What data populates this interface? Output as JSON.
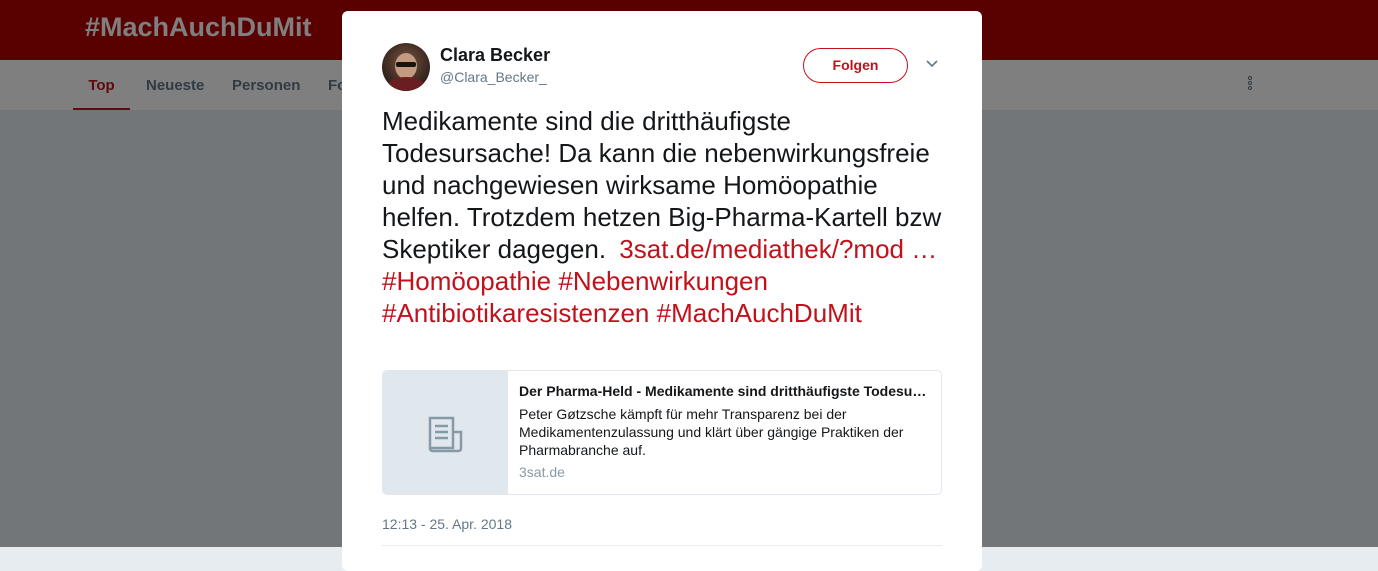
{
  "header": {
    "hashtag": "#MachAuchDuMit"
  },
  "tabs": [
    {
      "label": "Top"
    },
    {
      "label": "Neueste"
    },
    {
      "label": "Personen"
    },
    {
      "label": "Fo"
    }
  ],
  "tweet": {
    "display_name": "Clara Becker",
    "screen_name": "@Clara_Becker_",
    "follow_label": "Folgen",
    "text_plain": "Medikamente sind die dritthäufigste Todesursache! Da kann die nebenwirkungsfreie und nachgewiesen wirksame Homöopathie helfen. Trotzdem hetzen Big-Pharma-Kartell bzw Skeptiker dagegen.",
    "link": "3sat.de/mediathek/?mod …",
    "hashtags": [
      "#Homöopathie",
      "#Nebenwirkungen",
      "#Antibiotikaresistenzen",
      "#MachAuchDuMit"
    ],
    "timestamp": "12:13 - 25. Apr. 2018"
  },
  "card": {
    "title": "Der Pharma-Held - Medikamente sind dritthäufigste Todesursache",
    "description": "Peter Gøtzsche kämpft für mehr Transparenz bei der Medikamentenzulassung und klärt über gängige Praktiken der Pharmabranche auf.",
    "domain": "3sat.de"
  },
  "colors": {
    "brand": "#b20000",
    "link": "#c1121c",
    "muted": "#657786"
  }
}
